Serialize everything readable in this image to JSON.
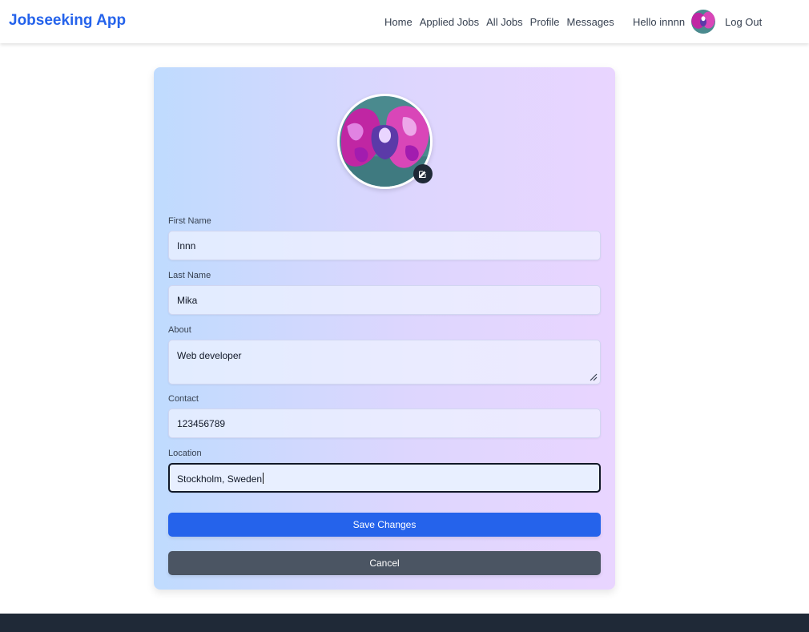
{
  "nav": {
    "brand": "Jobseeking App",
    "links": [
      "Home",
      "Applied Jobs",
      "All Jobs",
      "Profile",
      "Messages"
    ],
    "greeting": "Hello innnn",
    "logout": "Log Out"
  },
  "profile": {
    "fields": {
      "first_name": {
        "label": "First Name",
        "value": "Innn"
      },
      "last_name": {
        "label": "Last Name",
        "value": "Mika"
      },
      "about": {
        "label": "About",
        "value": "Web developer"
      },
      "contact": {
        "label": "Contact",
        "value": "123456789"
      },
      "location": {
        "label": "Location",
        "value": "Stockholm, Sweden"
      }
    },
    "save_label": "Save Changes",
    "cancel_label": "Cancel"
  },
  "icons": {
    "avatar_edit": "edit-icon",
    "nav_avatar": "avatar",
    "resize": "resize-handle-icon"
  },
  "colors": {
    "brand": "#2563eb",
    "save": "#2563eb",
    "cancel": "#4b5563",
    "footer": "#1f2937"
  }
}
